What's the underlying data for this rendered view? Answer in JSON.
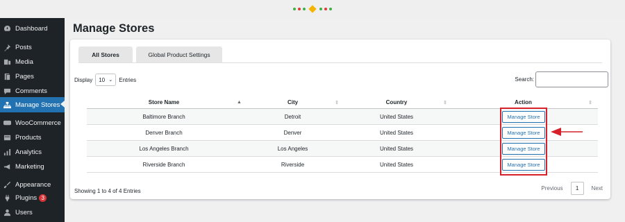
{
  "sidebar": {
    "items": [
      {
        "label": "Dashboard",
        "icon": "dashboard-icon",
        "active": false
      },
      {
        "label": "Posts",
        "icon": "pin-icon",
        "active": false
      },
      {
        "label": "Media",
        "icon": "media-icon",
        "active": false
      },
      {
        "label": "Pages",
        "icon": "page-icon",
        "active": false
      },
      {
        "label": "Comments",
        "icon": "comment-icon",
        "active": false
      },
      {
        "label": "Manage Stores",
        "icon": "store-network-icon",
        "active": true
      },
      {
        "label": "WooCommerce",
        "icon": "woo-icon",
        "active": false
      },
      {
        "label": "Products",
        "icon": "products-icon",
        "active": false
      },
      {
        "label": "Analytics",
        "icon": "bar-chart-icon",
        "active": false
      },
      {
        "label": "Marketing",
        "icon": "megaphone-icon",
        "active": false
      },
      {
        "label": "Appearance",
        "icon": "brush-icon",
        "active": false
      },
      {
        "label": "Plugins",
        "icon": "plug-icon",
        "active": false,
        "badge": "3"
      },
      {
        "label": "Users",
        "icon": "user-icon",
        "active": false
      }
    ]
  },
  "page": {
    "title": "Manage Stores"
  },
  "tabs": [
    {
      "label": "All Stores",
      "active": true
    },
    {
      "label": "Global Product Settings",
      "active": false
    }
  ],
  "controls": {
    "display_label": "Display",
    "page_size": "10",
    "entries_label": "Entries",
    "search_label": "Search:"
  },
  "table": {
    "columns": [
      "Store Name",
      "City",
      "Country",
      "Action"
    ],
    "rows": [
      {
        "store": "Baltimore Branch",
        "city": "Detroit",
        "country": "United States",
        "action": "Manage Store"
      },
      {
        "store": "Denver Branch",
        "city": "Denver",
        "country": "United States",
        "action": "Manage Store"
      },
      {
        "store": "Los Angeles Branch",
        "city": "Los Angeles",
        "country": "United States",
        "action": "Manage Store"
      },
      {
        "store": "Riverside Branch",
        "city": "Riverside",
        "country": "United States",
        "action": "Manage Store"
      }
    ]
  },
  "footer": {
    "showing": "Showing 1 to 4 of 4 Entries",
    "previous": "Previous",
    "current_page": "1",
    "next": "Next"
  },
  "colors": {
    "sidebar_bg": "#1d2327",
    "accent": "#2271b1",
    "highlight": "#d6212a"
  }
}
